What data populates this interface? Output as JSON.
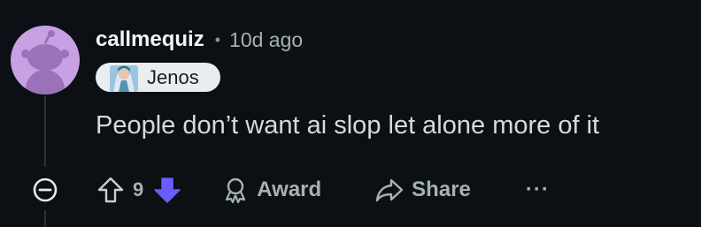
{
  "comment": {
    "username": "callmequiz",
    "separator": "•",
    "timestamp": "10d ago",
    "flair_text": "Jenos",
    "body": "People don’t want ai slop let alone more of it",
    "score": "9",
    "award_label": "Award",
    "share_label": "Share",
    "more_label": "···"
  },
  "colors": {
    "background": "#0c1014",
    "avatar_bg": "#c8a1e4",
    "downvote_active": "#6a5cff",
    "flair_bg": "#eaedef",
    "muted_text": "#a4b1b6"
  },
  "icons": {
    "avatar": "snoo-avatar-icon",
    "collapse": "collapse-minus-icon",
    "upvote": "upvote-arrow-icon",
    "downvote": "downvote-arrow-icon",
    "award": "award-ribbon-icon",
    "share": "share-arrow-icon"
  }
}
